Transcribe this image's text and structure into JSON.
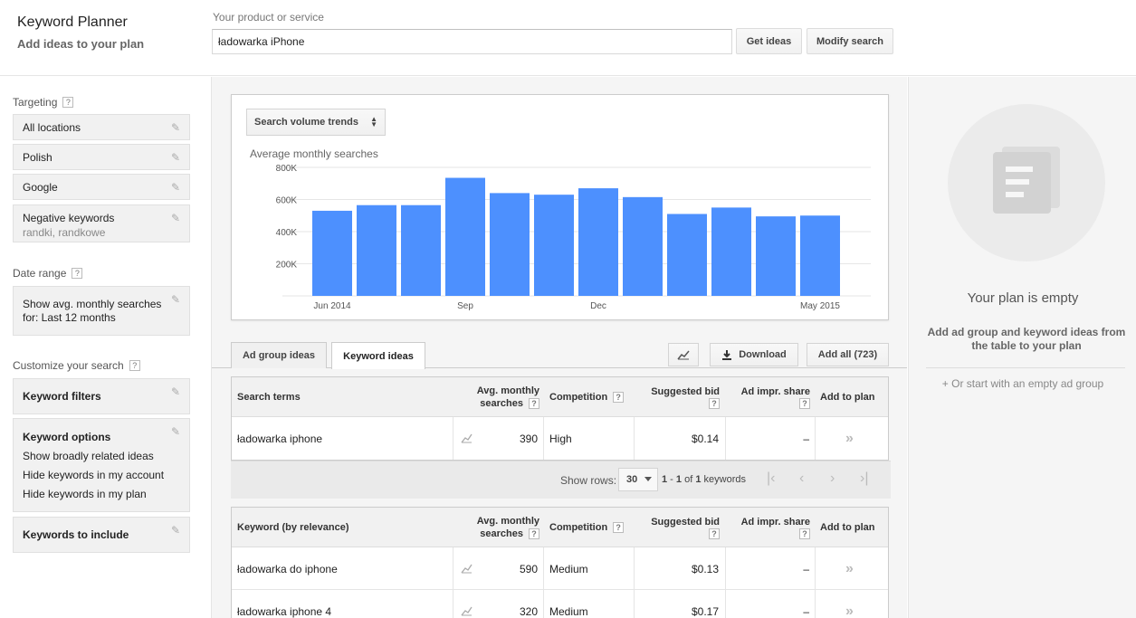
{
  "header": {
    "app_title": "Keyword Planner",
    "app_subtitle": "Add ideas to your plan",
    "product_label": "Your product or service",
    "product_value": "ładowarka iPhone",
    "get_ideas_label": "Get ideas",
    "modify_search_label": "Modify search"
  },
  "sidebar": {
    "targeting_label": "Targeting",
    "targeting_items": [
      {
        "label": "All locations"
      },
      {
        "label": "Polish"
      },
      {
        "label": "Google"
      },
      {
        "label": "Negative keywords",
        "sub": "randki, randkowe"
      }
    ],
    "date_range_label": "Date range",
    "date_range_value": "Show avg. monthly searches for: Last 12 months",
    "customize_label": "Customize your search",
    "keyword_filters_label": "Keyword filters",
    "keyword_options_label": "Keyword options",
    "keyword_options": [
      "Show broadly related ideas",
      "Hide keywords in my account",
      "Hide keywords in my plan"
    ],
    "keywords_to_include_label": "Keywords to include",
    "help_glyph": "?"
  },
  "chart": {
    "select_label": "Search volume trends",
    "title": "Average monthly searches"
  },
  "chart_data": {
    "type": "bar",
    "title": "Average monthly searches",
    "categories": [
      "Jun 2014",
      "Jul 2014",
      "Aug 2014",
      "Sep 2014",
      "Oct 2014",
      "Nov 2014",
      "Dec 2014",
      "Jan 2015",
      "Feb 2015",
      "Mar 2015",
      "Apr 2015",
      "May 2015"
    ],
    "x_tick_labels": [
      "Jun 2014",
      "",
      "",
      "Sep",
      "",
      "",
      "Dec",
      "",
      "",
      "",
      "",
      "May 2015"
    ],
    "values": [
      530000,
      565000,
      565000,
      735000,
      640000,
      630000,
      670000,
      615000,
      510000,
      550000,
      495000,
      500000
    ],
    "y_ticks": [
      "200K",
      "400K",
      "600K",
      "800K"
    ],
    "ylim": [
      0,
      800000
    ],
    "grid": true,
    "bar_color": "#4d90fe"
  },
  "tabs": {
    "ad_group_ideas": "Ad group ideas",
    "keyword_ideas": "Keyword ideas",
    "download": "Download",
    "add_all": "Add all (723)"
  },
  "search_terms_table": {
    "headers": {
      "term": "Search terms",
      "avg_line1": "Avg. monthly",
      "avg_line2": "searches",
      "competition": "Competition",
      "bid": "Suggested bid",
      "impr": "Ad impr. share",
      "add": "Add to plan"
    },
    "rows": [
      {
        "keyword": "ładowarka iphone",
        "searches": "390",
        "competition": "High",
        "bid": "$0.14",
        "impr": "–",
        "add": "»"
      }
    ]
  },
  "pager": {
    "show_rows_label": "Show rows:",
    "rows_value": "30",
    "range_start": "1",
    "range_end": "1",
    "of_label": "of",
    "total": "1",
    "unit": "keywords"
  },
  "keyword_table": {
    "headers": {
      "term": "Keyword (by relevance)",
      "avg_line1": "Avg. monthly",
      "avg_line2": "searches",
      "competition": "Competition",
      "bid": "Suggested bid",
      "impr": "Ad impr. share",
      "add": "Add to plan"
    },
    "rows": [
      {
        "keyword": "ładowarka do iphone",
        "searches": "590",
        "competition": "Medium",
        "bid": "$0.13",
        "impr": "–",
        "add": "»"
      },
      {
        "keyword": "ładowarka iphone 4",
        "searches": "320",
        "competition": "Medium",
        "bid": "$0.17",
        "impr": "–",
        "add": "»"
      }
    ]
  },
  "plan": {
    "empty_title": "Your plan is empty",
    "description": "Add ad group and keyword ideas from the table to your plan",
    "start_empty_link": "+ Or start with an empty ad group"
  }
}
